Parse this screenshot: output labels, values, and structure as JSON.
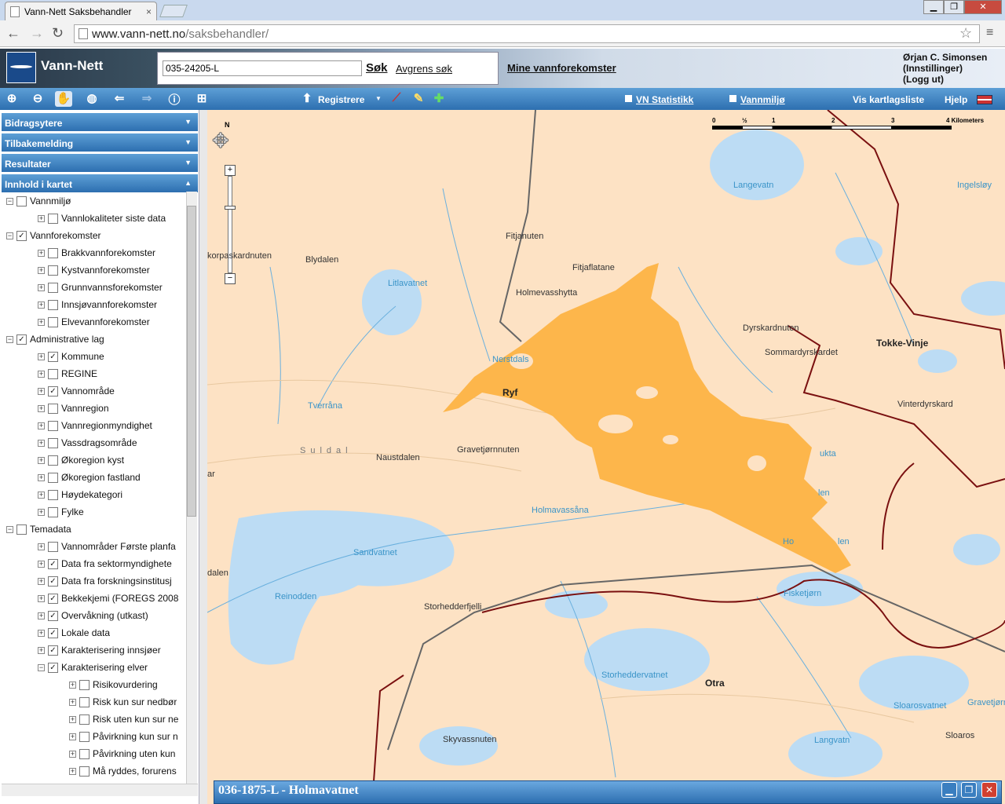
{
  "browser": {
    "tab_title": "Vann-Nett Saksbehandler",
    "tab_close": "×",
    "url_domain": "www.vann-nett.no",
    "url_path": "/saksbehandler/"
  },
  "header": {
    "app_title": "Vann-Nett",
    "search_value": "035-24205-L",
    "search_button": "Søk",
    "refine_link": "Avgrens søk",
    "my_waterbodies": "Mine vannforekomster",
    "user_name": "Ørjan C. Simonsen",
    "user_settings": "(Innstillinger)",
    "user_logout": "(Logg ut)"
  },
  "toolbar": {
    "register": "Registrere",
    "vn_stats": "VN Statistikk",
    "vannmiljo": "Vannmiljø",
    "layer_list": "Vis kartlagsliste",
    "help": "Hjelp"
  },
  "sidebar": {
    "sections": [
      "Bidragsytere",
      "Tilbakemelding",
      "Resultater",
      "Innhold i kartet"
    ],
    "tree": [
      {
        "label": "Vannmiljø",
        "level": 0,
        "checked": false,
        "exp": "−"
      },
      {
        "label": "Vannlokaliteter siste data",
        "level": 1,
        "checked": false,
        "exp": "+"
      },
      {
        "label": "Vannforekomster",
        "level": 0,
        "checked": true,
        "exp": "−"
      },
      {
        "label": "Brakkvannforekomster",
        "level": 1,
        "checked": false,
        "exp": "+"
      },
      {
        "label": "Kystvannforekomster",
        "level": 1,
        "checked": false,
        "exp": "+"
      },
      {
        "label": "Grunnvannsforekomster",
        "level": 1,
        "checked": false,
        "exp": "+"
      },
      {
        "label": "Innsjøvannforekomster",
        "level": 1,
        "checked": false,
        "exp": "+"
      },
      {
        "label": "Elvevannforekomster",
        "level": 1,
        "checked": false,
        "exp": "+"
      },
      {
        "label": "Administrative lag",
        "level": 0,
        "checked": true,
        "exp": "−"
      },
      {
        "label": "Kommune",
        "level": 1,
        "checked": true,
        "exp": "+"
      },
      {
        "label": "REGINE",
        "level": 1,
        "checked": false,
        "exp": "+"
      },
      {
        "label": "Vannområde",
        "level": 1,
        "checked": true,
        "exp": "+"
      },
      {
        "label": "Vannregion",
        "level": 1,
        "checked": false,
        "exp": "+"
      },
      {
        "label": "Vannregionmyndighet",
        "level": 1,
        "checked": false,
        "exp": "+"
      },
      {
        "label": "Vassdragsområde",
        "level": 1,
        "checked": false,
        "exp": "+"
      },
      {
        "label": "Økoregion kyst",
        "level": 1,
        "checked": false,
        "exp": "+"
      },
      {
        "label": "Økoregion fastland",
        "level": 1,
        "checked": false,
        "exp": "+"
      },
      {
        "label": "Høydekategori",
        "level": 1,
        "checked": false,
        "exp": "+"
      },
      {
        "label": "Fylke",
        "level": 1,
        "checked": false,
        "exp": "+"
      },
      {
        "label": "Temadata",
        "level": 0,
        "checked": false,
        "exp": "−"
      },
      {
        "label": "Vannområder Første planfa",
        "level": 1,
        "checked": false,
        "exp": "+"
      },
      {
        "label": "Data fra sektormyndighete",
        "level": 1,
        "checked": true,
        "exp": "+"
      },
      {
        "label": "Data fra forskningsinstitusj",
        "level": 1,
        "checked": true,
        "exp": "+"
      },
      {
        "label": "Bekkekjemi (FOREGS 2008",
        "level": 1,
        "checked": true,
        "exp": "+"
      },
      {
        "label": "Overvåkning (utkast)",
        "level": 1,
        "checked": true,
        "exp": "+"
      },
      {
        "label": "Lokale data",
        "level": 1,
        "checked": true,
        "exp": "+"
      },
      {
        "label": "Karakterisering innsjøer",
        "level": 1,
        "checked": true,
        "exp": "+"
      },
      {
        "label": "Karakterisering elver",
        "level": 1,
        "checked": true,
        "exp": "−"
      },
      {
        "label": "Risikovurdering",
        "level": 2,
        "checked": false,
        "exp": "+"
      },
      {
        "label": "Risk kun sur nedbør",
        "level": 2,
        "checked": false,
        "exp": "+"
      },
      {
        "label": "Risk uten kun sur ne",
        "level": 2,
        "checked": false,
        "exp": "+"
      },
      {
        "label": "Påvirkning kun sur n",
        "level": 2,
        "checked": false,
        "exp": "+"
      },
      {
        "label": "Påvirkning uten kun",
        "level": 2,
        "checked": false,
        "exp": "+"
      },
      {
        "label": "Må ryddes, forurens",
        "level": 2,
        "checked": false,
        "exp": "+"
      }
    ]
  },
  "map": {
    "scale_labels": [
      "0",
      "½",
      "1",
      "2",
      "3",
      "4 Kilometers"
    ],
    "labels": [
      {
        "t": "Langevatn",
        "w": true
      },
      {
        "t": "Ingelsløy",
        "w": true
      },
      {
        "t": "Fitjanuten",
        "w": false
      },
      {
        "t": "korpaskardnuten",
        "w": false
      },
      {
        "t": "Blydalen",
        "w": false
      },
      {
        "t": "Fitjaflatane",
        "w": false
      },
      {
        "t": "Litlavatnet",
        "w": true
      },
      {
        "t": "Holmevasshytta",
        "w": false
      },
      {
        "t": "Dyrskardnuten",
        "w": false
      },
      {
        "t": "Tokke-Vinje",
        "w": false
      },
      {
        "t": "Sommardyrskardet",
        "w": false
      },
      {
        "t": "Nerstdals",
        "w": true
      },
      {
        "t": "Ryf",
        "w": false
      },
      {
        "t": "Vinterdyrskard",
        "w": false
      },
      {
        "t": "Tverråna",
        "w": true
      },
      {
        "t": "Suldal",
        "w": false
      },
      {
        "t": "Naustdalen",
        "w": false
      },
      {
        "t": "Gravetjørnnuten",
        "w": false
      },
      {
        "t": "ukta",
        "w": true
      },
      {
        "t": "len",
        "w": true
      },
      {
        "t": "Holmavassåna",
        "w": true
      },
      {
        "t": "Sandvatnet",
        "w": true
      },
      {
        "t": "Ho",
        "w": true
      },
      {
        "t": "len",
        "w": true
      },
      {
        "t": "dalen",
        "w": false
      },
      {
        "t": "Reinodden",
        "w": true
      },
      {
        "t": "Fisketjørn",
        "w": true
      },
      {
        "t": "Storhedderfjelli",
        "w": false
      },
      {
        "t": "Storheddervatnet",
        "w": true
      },
      {
        "t": "Otra",
        "w": false
      },
      {
        "t": "Gravetjørn",
        "w": true
      },
      {
        "t": "Sloarosvatnet",
        "w": true
      },
      {
        "t": "Skyvassnuten",
        "w": false
      },
      {
        "t": "Langvatn",
        "w": true
      },
      {
        "t": "Sloaros",
        "w": false
      },
      {
        "t": "ar",
        "w": false
      }
    ]
  },
  "popup": {
    "title": "036-1875-L - Holmavatnet"
  },
  "colors": {
    "highlight": "#fdb64b",
    "land": "#fde2c4",
    "water": "#bcdcf4",
    "border": "#7a1010",
    "toolbar": "#2d6fb0"
  }
}
